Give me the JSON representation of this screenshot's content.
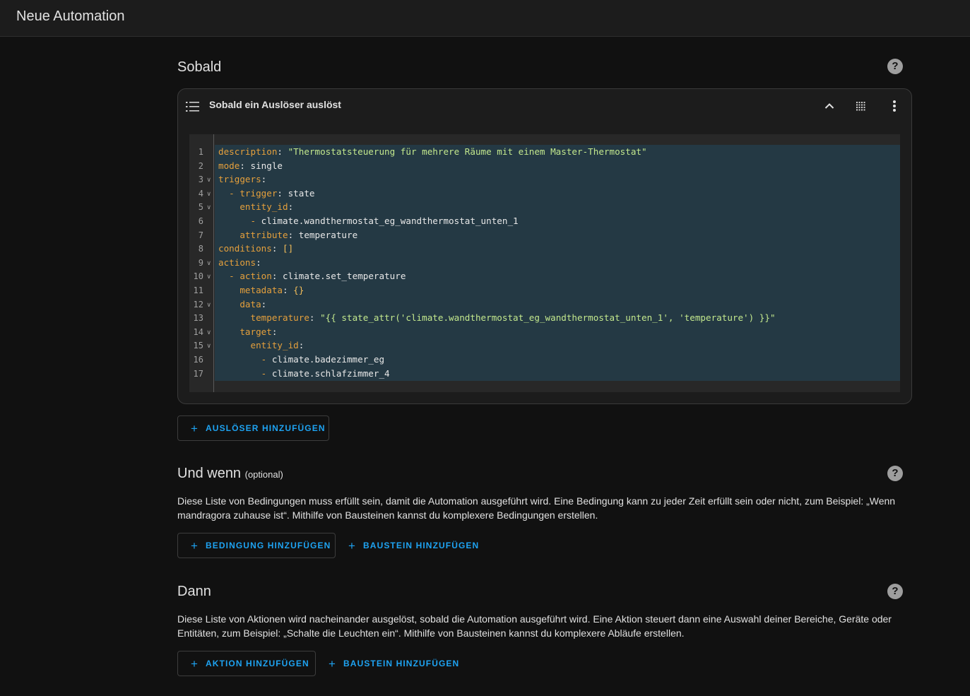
{
  "header": {
    "title": "Neue Automation"
  },
  "triggers_section": {
    "title": "Sobald",
    "card_title": "Sobald ein Auslöser auslöst",
    "add_button": "AUSLÖSER HINZUFÜGEN"
  },
  "conditions_section": {
    "title": "Und wenn",
    "optional": "(optional)",
    "description": "Diese Liste von Bedingungen muss erfüllt sein, damit die Automation ausgeführt wird. Eine Bedingung kann zu jeder Zeit erfüllt sein oder nicht, zum Beispiel: „Wenn mandragora zuhause ist“. Mithilfe von Bausteinen kannst du komplexere Bedingungen erstellen.",
    "add_button": "BEDINGUNG HINZUFÜGEN",
    "block_button": "BAUSTEIN HINZUFÜGEN"
  },
  "actions_section": {
    "title": "Dann",
    "description": "Diese Liste von Aktionen wird nacheinander ausgelöst, sobald die Automation ausgeführt wird. Eine Aktion steuert dann eine Auswahl deiner Bereiche, Geräte oder Entitäten, zum Beispiel: „Schalte die Leuchten ein“. Mithilfe von Bausteinen kannst du komplexere Abläufe erstellen.",
    "add_button": "AKTION HINZUFÜGEN",
    "block_button": "BAUSTEIN HINZUFÜGEN"
  },
  "help_icon": "?",
  "plus_icon": "+",
  "code": {
    "line_numbers": [
      "1",
      "2",
      "3",
      "4",
      "5",
      "6",
      "7",
      "8",
      "9",
      "10",
      "11",
      "12",
      "13",
      "14",
      "15",
      "16",
      "17"
    ],
    "folds": [
      "3",
      "4",
      "5",
      "9",
      "10",
      "12",
      "14",
      "15"
    ],
    "lines": [
      [
        {
          "t": "description",
          "c": "k"
        },
        {
          "t": ": ",
          "c": "p"
        },
        {
          "t": "\"Thermostatsteuerung für mehrere Räume mit einem Master-Thermostat\"",
          "c": "s"
        }
      ],
      [
        {
          "t": "mode",
          "c": "k"
        },
        {
          "t": ": single",
          "c": "p"
        }
      ],
      [
        {
          "t": "triggers",
          "c": "k"
        },
        {
          "t": ":",
          "c": "p"
        }
      ],
      [
        {
          "t": "  - ",
          "c": "k"
        },
        {
          "t": "trigger",
          "c": "k"
        },
        {
          "t": ": state",
          "c": "p"
        }
      ],
      [
        {
          "t": "    entity_id",
          "c": "k"
        },
        {
          "t": ":",
          "c": "p"
        }
      ],
      [
        {
          "t": "      - ",
          "c": "k"
        },
        {
          "t": "climate.wandthermostat_eg_wandthermostat_unten_1",
          "c": "p"
        }
      ],
      [
        {
          "t": "    attribute",
          "c": "k"
        },
        {
          "t": ": temperature",
          "c": "p"
        }
      ],
      [
        {
          "t": "conditions",
          "c": "k"
        },
        {
          "t": ": ",
          "c": "p"
        },
        {
          "t": "[]",
          "c": "pct"
        }
      ],
      [
        {
          "t": "actions",
          "c": "k"
        },
        {
          "t": ":",
          "c": "p"
        }
      ],
      [
        {
          "t": "  - ",
          "c": "k"
        },
        {
          "t": "action",
          "c": "k"
        },
        {
          "t": ": climate.set_temperature",
          "c": "p"
        }
      ],
      [
        {
          "t": "    metadata",
          "c": "k"
        },
        {
          "t": ": ",
          "c": "p"
        },
        {
          "t": "{}",
          "c": "pct"
        }
      ],
      [
        {
          "t": "    data",
          "c": "k"
        },
        {
          "t": ":",
          "c": "p"
        }
      ],
      [
        {
          "t": "      temperature",
          "c": "k"
        },
        {
          "t": ": ",
          "c": "p"
        },
        {
          "t": "\"{{ state_attr('climate.wandthermostat_eg_wandthermostat_unten_1', 'temperature') }}\"",
          "c": "s"
        }
      ],
      [
        {
          "t": "    target",
          "c": "k"
        },
        {
          "t": ":",
          "c": "p"
        }
      ],
      [
        {
          "t": "      entity_id",
          "c": "k"
        },
        {
          "t": ":",
          "c": "p"
        }
      ],
      [
        {
          "t": "        - ",
          "c": "k"
        },
        {
          "t": "climate.badezimmer_eg",
          "c": "p"
        }
      ],
      [
        {
          "t": "        - ",
          "c": "k"
        },
        {
          "t": "climate.schlafzimmer_4",
          "c": "p"
        }
      ]
    ]
  }
}
